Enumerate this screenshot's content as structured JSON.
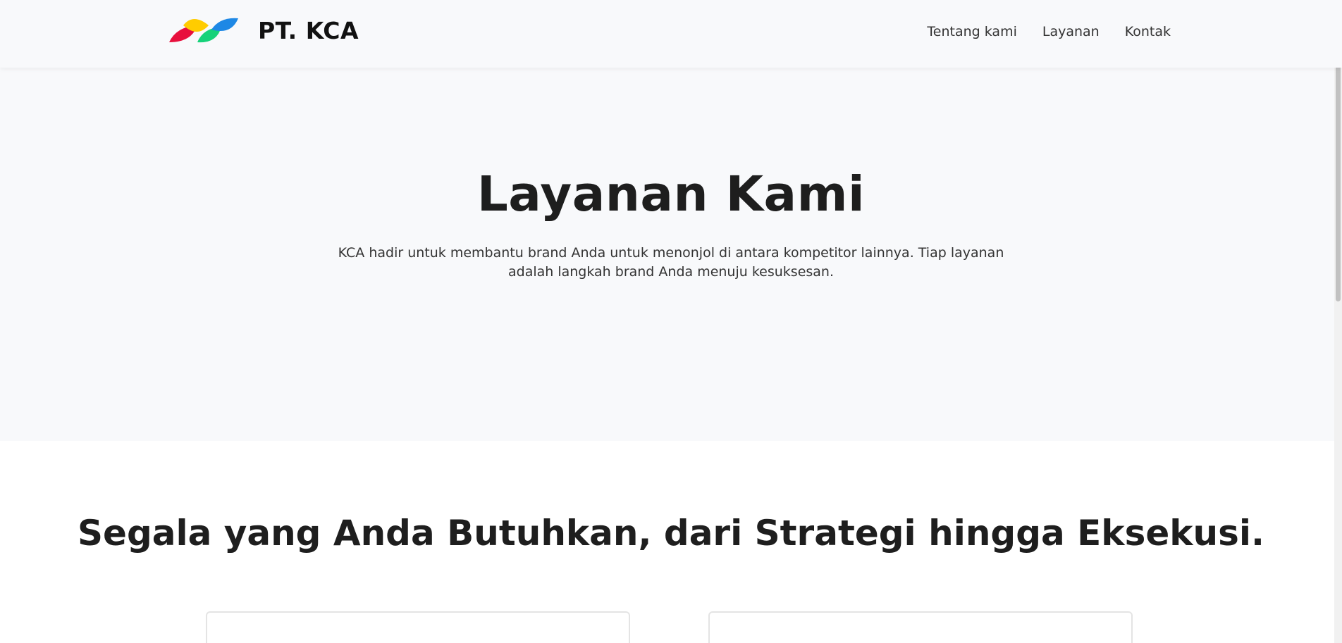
{
  "header": {
    "brand_name": "PT. KCA",
    "logo_icon": "three-petal-logo",
    "logo_colors": [
      "#e8103d",
      "#ffcc00",
      "#16d27a",
      "#1e88e5"
    ],
    "nav": [
      {
        "label": "Tentang kami"
      },
      {
        "label": "Layanan"
      },
      {
        "label": "Kontak"
      }
    ]
  },
  "hero": {
    "title": "Layanan Kami",
    "description": "KCA hadir untuk membantu brand Anda untuk menonjol di antara kompetitor lainnya. Tiap layanan adalah langkah brand Anda menuju kesuksesan."
  },
  "services": {
    "heading": "Segala yang Anda Butuhkan, dari Strategi hingga Eksekusi."
  }
}
